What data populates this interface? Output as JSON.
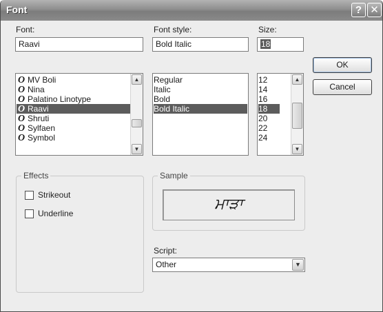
{
  "window": {
    "title": "Font",
    "help_glyph": "?",
    "close_glyph": "✕"
  },
  "font": {
    "label": "Font:",
    "value": "Raavi",
    "items": [
      {
        "icon": "O",
        "label": "MV Boli",
        "selected": false
      },
      {
        "icon": "O",
        "label": "Nina",
        "selected": false
      },
      {
        "icon": "O",
        "label": "Palatino Linotype",
        "selected": false
      },
      {
        "icon": "O",
        "label": "Raavi",
        "selected": true
      },
      {
        "icon": "O",
        "label": "Shruti",
        "selected": false
      },
      {
        "icon": "O",
        "label": "Sylfaen",
        "selected": false
      },
      {
        "icon": "O",
        "label": "Symbol",
        "selected": false
      }
    ]
  },
  "style": {
    "label": "Font style:",
    "value": "Bold Italic",
    "items": [
      {
        "label": "Regular",
        "selected": false
      },
      {
        "label": "Italic",
        "selected": false
      },
      {
        "label": "Bold",
        "selected": false
      },
      {
        "label": "Bold Italic",
        "selected": true
      }
    ]
  },
  "size": {
    "label": "Size:",
    "value": "18",
    "items": [
      {
        "label": "12",
        "selected": false
      },
      {
        "label": "14",
        "selected": false
      },
      {
        "label": "16",
        "selected": false
      },
      {
        "label": "18",
        "selected": true
      },
      {
        "label": "20",
        "selected": false
      },
      {
        "label": "22",
        "selected": false
      },
      {
        "label": "24",
        "selected": false
      }
    ]
  },
  "buttons": {
    "ok": "OK",
    "cancel": "Cancel"
  },
  "effects": {
    "title": "Effects",
    "strikeout": "Strikeout",
    "underline": "Underline"
  },
  "sample": {
    "title": "Sample",
    "text": "ਮਾੜਾ"
  },
  "script": {
    "label": "Script:",
    "value": "Other"
  },
  "icons": {
    "font_type": "opentype-font-icon",
    "scroll_up": "▲",
    "scroll_down": "▼",
    "dropdown": "▼"
  }
}
